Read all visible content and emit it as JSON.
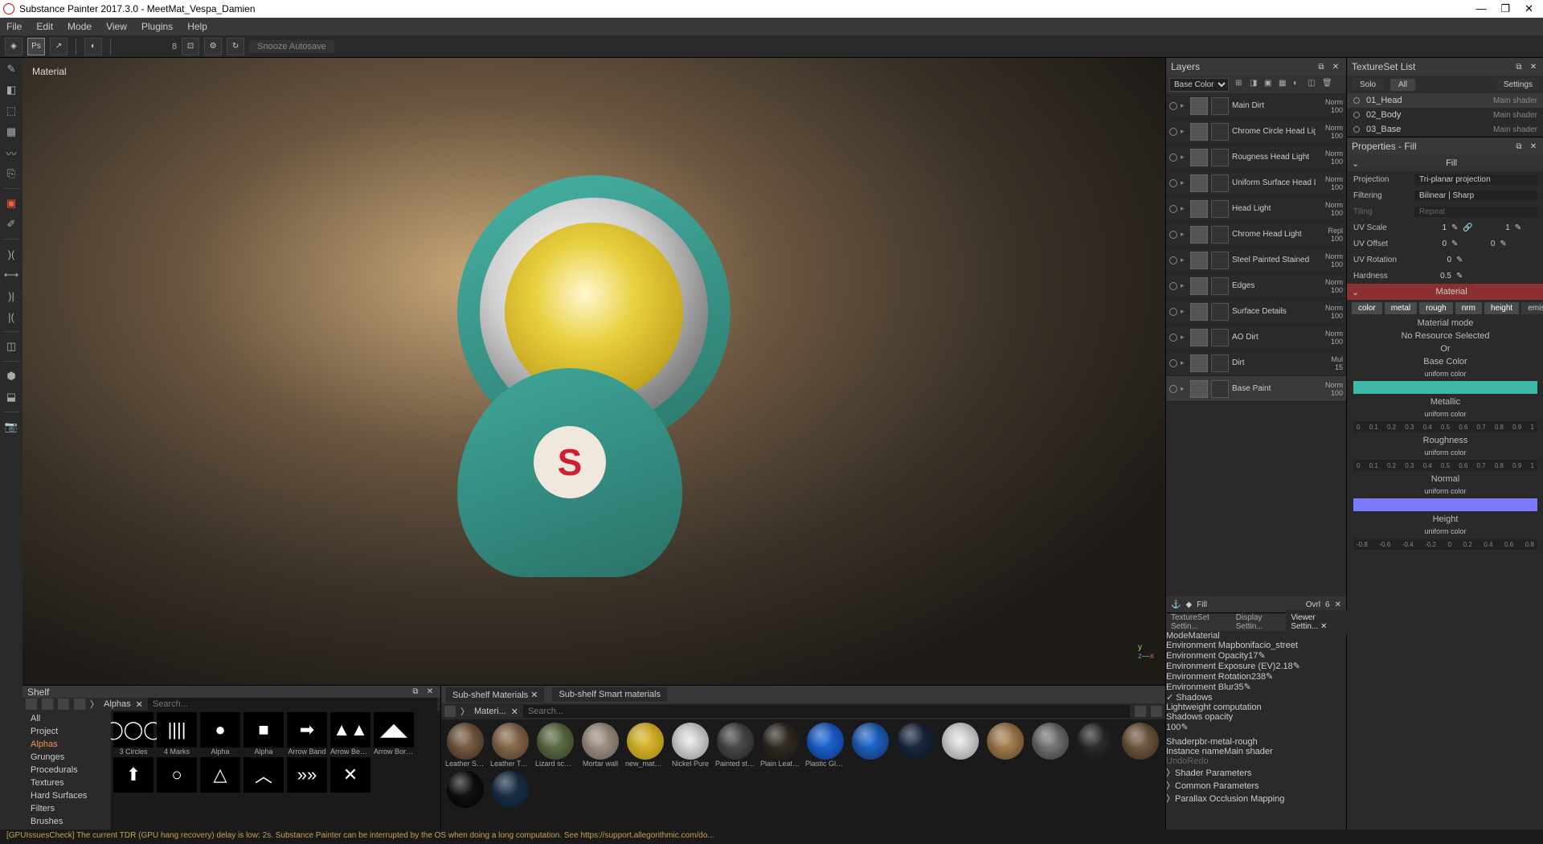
{
  "app": {
    "title": "Substance Painter 2017.3.0 - MeetMat_Vespa_Damien"
  },
  "menu": [
    "File",
    "Edit",
    "Mode",
    "View",
    "Plugins",
    "Help"
  ],
  "toolbar": {
    "snooze": "Snooze Autosave",
    "brush_size": "8"
  },
  "viewport": {
    "label": "Material"
  },
  "shelf": {
    "title": "Shelf",
    "filter_label": "Alphas",
    "search_placeholder": "Search...",
    "cats": [
      "All",
      "Project",
      "Alphas",
      "Grunges",
      "Procedurals",
      "Textures",
      "Hard Surfaces",
      "Filters",
      "Brushes"
    ],
    "cat_selected": "Alphas",
    "alphas": [
      "3 Circles",
      "4 Marks",
      "Alpha",
      "Alpha",
      "Arrow Band",
      "Arrow Bend ...",
      "Arrow Borde...",
      "",
      "",
      "",
      "",
      "",
      ""
    ]
  },
  "subshelf": {
    "tabs": [
      "Sub-shelf Materials",
      "Sub-shelf Smart materials"
    ],
    "materi_label": "Materi...",
    "search_placeholder": "Search...",
    "mats": [
      {
        "name": "Leather Soft...",
        "c1": "#8a6a50",
        "c2": "#3a2a1c"
      },
      {
        "name": "Leather Tou...",
        "c1": "#9a7a5a",
        "c2": "#4a3524"
      },
      {
        "name": "Lizard scales",
        "c1": "#6a7a50",
        "c2": "#303a20"
      },
      {
        "name": "Mortar wall",
        "c1": "#b0a090",
        "c2": "#605850"
      },
      {
        "name": "new_materia...",
        "c1": "#e0c030",
        "c2": "#a08010"
      },
      {
        "name": "Nickel Pure",
        "c1": "#eee",
        "c2": "#888"
      },
      {
        "name": "Painted steel",
        "c1": "#555",
        "c2": "#222"
      },
      {
        "name": "Plain Leather",
        "c1": "#3a3328",
        "c2": "#181410"
      },
      {
        "name": "Plastic Gloss...",
        "c1": "#2070e0",
        "c2": "#0a3080"
      },
      {
        "name": "",
        "c1": "#2070e0",
        "c2": "#103060"
      },
      {
        "name": "",
        "c1": "#20304a",
        "c2": "#0a1020"
      },
      {
        "name": "",
        "c1": "#eee",
        "c2": "#888"
      },
      {
        "name": "",
        "c1": "#b89060",
        "c2": "#5a4020"
      },
      {
        "name": "",
        "c1": "#888",
        "c2": "#333"
      },
      {
        "name": "",
        "c1": "#333",
        "c2": "#111"
      },
      {
        "name": "",
        "c1": "#806850",
        "c2": "#3a2a18"
      },
      {
        "name": "",
        "c1": "#181818",
        "c2": "#000"
      },
      {
        "name": "",
        "c1": "#203850",
        "c2": "#0a1828"
      }
    ]
  },
  "layers": {
    "title": "Layers",
    "channel": "Base Color",
    "items": [
      {
        "name": "Main Dirt",
        "blend": "Norm",
        "op": "100"
      },
      {
        "name": "Chrome Circle Head Light",
        "blend": "Norm",
        "op": "100"
      },
      {
        "name": "Rougness Head Light",
        "blend": "Norm",
        "op": "100"
      },
      {
        "name": "Uniform Surface Head Light",
        "blend": "Norm",
        "op": "100"
      },
      {
        "name": "Head Light",
        "blend": "Norm",
        "op": "100"
      },
      {
        "name": "Chrome Head Light",
        "blend": "Repl",
        "op": "100"
      },
      {
        "name": "Steel Painted Stained",
        "blend": "Norm",
        "op": "100"
      },
      {
        "name": "Edges",
        "blend": "Norm",
        "op": "100"
      },
      {
        "name": "Surface Details",
        "blend": "Norm",
        "op": "100"
      },
      {
        "name": "AO Dirt",
        "blend": "Norm",
        "op": "100"
      },
      {
        "name": "Dirt",
        "blend": "Mul",
        "op": "15"
      },
      {
        "name": "Base Paint",
        "blend": "Norm",
        "op": "100",
        "sel": true
      }
    ],
    "fill": {
      "label": "Fill",
      "mode": "Ovrl",
      "val": "6"
    }
  },
  "tsl": {
    "title": "TextureSet List",
    "solo": "Solo",
    "all": "All",
    "settings": "Settings",
    "items": [
      {
        "name": "01_Head",
        "shader": "Main shader",
        "sel": true
      },
      {
        "name": "02_Body",
        "shader": "Main shader"
      },
      {
        "name": "03_Base",
        "shader": "Main shader"
      }
    ]
  },
  "props": {
    "title": "Properties - Fill",
    "fill": "Fill",
    "projection": {
      "label": "Projection",
      "value": "Tri-planar projection"
    },
    "filtering": {
      "label": "Filtering",
      "value": "Bilinear | Sharp"
    },
    "tiling": {
      "label": "Tiling",
      "value": "Repeat"
    },
    "uvscale": {
      "label": "UV Scale",
      "v1": "1",
      "v2": "1"
    },
    "uvoffset": {
      "label": "UV Offset",
      "v1": "0",
      "v2": "0"
    },
    "uvrot": {
      "label": "UV Rotation",
      "v": "0"
    },
    "hardness": {
      "label": "Hardness",
      "v": "0.5"
    },
    "material": "Material",
    "chips": [
      "color",
      "metal",
      "rough",
      "nrm",
      "height",
      "emiss"
    ],
    "matmode": "Material mode",
    "nores": "No Resource Selected",
    "or": "Or",
    "basecolor": {
      "h": "Base Color",
      "s": "uniform color"
    },
    "metallic": {
      "h": "Metallic",
      "s": "uniform color"
    },
    "roughness": {
      "h": "Roughness",
      "s": "uniform color"
    },
    "normal": {
      "h": "Normal",
      "s": "uniform color"
    },
    "height": {
      "h": "Height",
      "s": "uniform color"
    }
  },
  "viewer": {
    "tabs": [
      "TextureSet Settin...",
      "Display Settin...",
      "Viewer Settin..."
    ],
    "mode": {
      "label": "Mode",
      "value": "Material"
    },
    "envmap": {
      "label": "Environment Map",
      "value": "bonifacio_street"
    },
    "envop": {
      "label": "Environment Opacity",
      "value": "17"
    },
    "envexp": {
      "label": "Environment Exposure (EV)",
      "value": "2.18"
    },
    "envrot": {
      "label": "Environment Rotation",
      "value": "238"
    },
    "envblur": {
      "label": "Environment Blur",
      "value": "35"
    },
    "shadows": {
      "label": "Shadows",
      "value": "Lightweight computation"
    },
    "shadop": {
      "label": "Shadows opacity",
      "value": "100"
    },
    "shader": {
      "label": "Shader",
      "value": "pbr-metal-rough"
    },
    "instance": {
      "label": "Instance name",
      "value": "Main shader"
    },
    "undo": "Undo",
    "redo": "Redo",
    "sections": [
      "Shader Parameters",
      "Common Parameters",
      "Parallax Occlusion Mapping"
    ]
  },
  "status": "[GPUIssuesCheck] The current TDR (GPU hang recovery) delay is low: 2s. Substance Painter can be interrupted by the OS when doing a long computation. See https://support.allegorithmic.com/do..."
}
